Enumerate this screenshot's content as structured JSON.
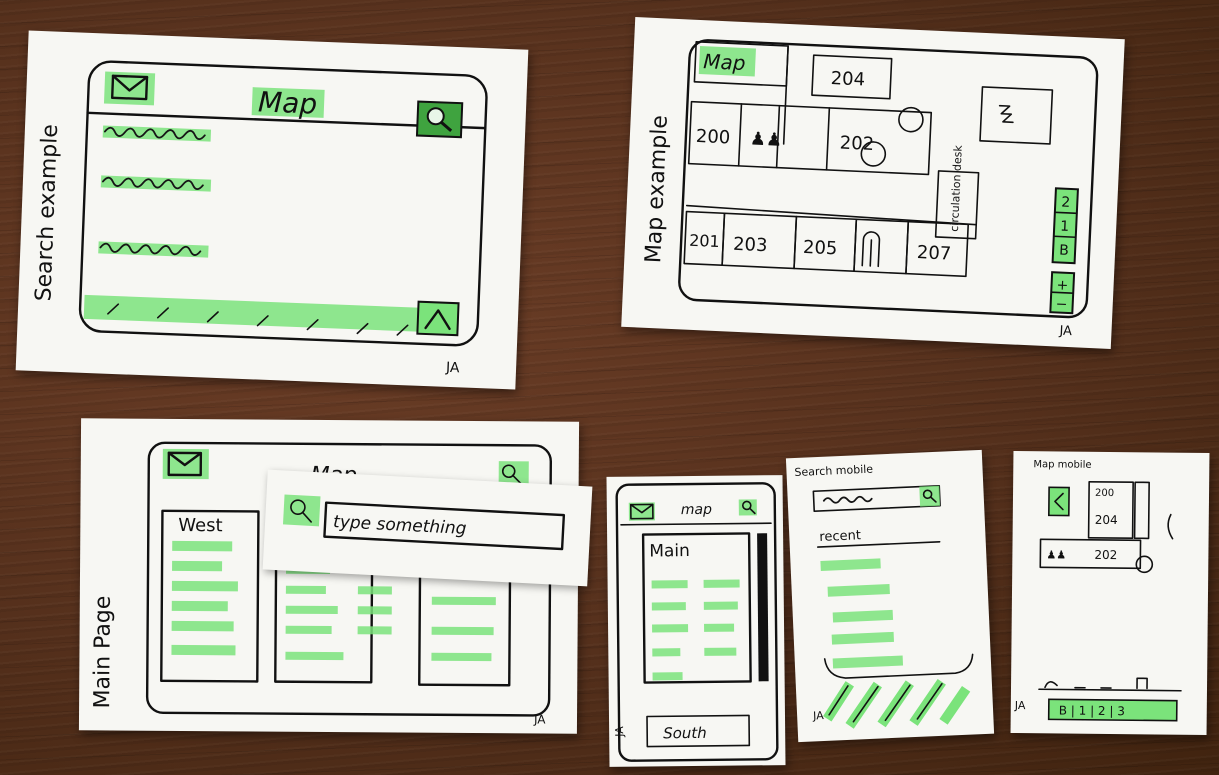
{
  "accent_colors": {
    "highlighter": "#7be37b",
    "ink": "#111111",
    "table": "#55301c"
  },
  "cards": {
    "search_example": {
      "side_label": "Search example",
      "title": "Map",
      "initials": "JA",
      "icons": [
        "mail-icon",
        "search-icon",
        "chevron-up-icon"
      ]
    },
    "map_example": {
      "side_label": "Map example",
      "back_label": "Map",
      "rooms": [
        "204",
        "200",
        "202",
        "201",
        "203",
        "205",
        "207"
      ],
      "desk_label": "circulation desk",
      "floor_buttons": [
        "2",
        "1",
        "B"
      ],
      "zoom_buttons": [
        "+",
        "−"
      ],
      "initials": "JA"
    },
    "main_page": {
      "side_label": "Main Page",
      "title": "Map",
      "column_heading": "West",
      "initials": "JA"
    },
    "search_overlay": {
      "input_text": "type something"
    },
    "main_mobile": {
      "title": "map",
      "panel_heading": "Main",
      "footer_label": "South",
      "initials": "JA"
    },
    "search_mobile": {
      "title": "Search mobile",
      "section_label": "recent",
      "initials": "JA"
    },
    "map_mobile": {
      "title": "Map mobile",
      "rooms": [
        "200",
        "204",
        "202"
      ],
      "floor_tabs": "B | 1 | 2 | 3",
      "initials": "JA"
    }
  }
}
